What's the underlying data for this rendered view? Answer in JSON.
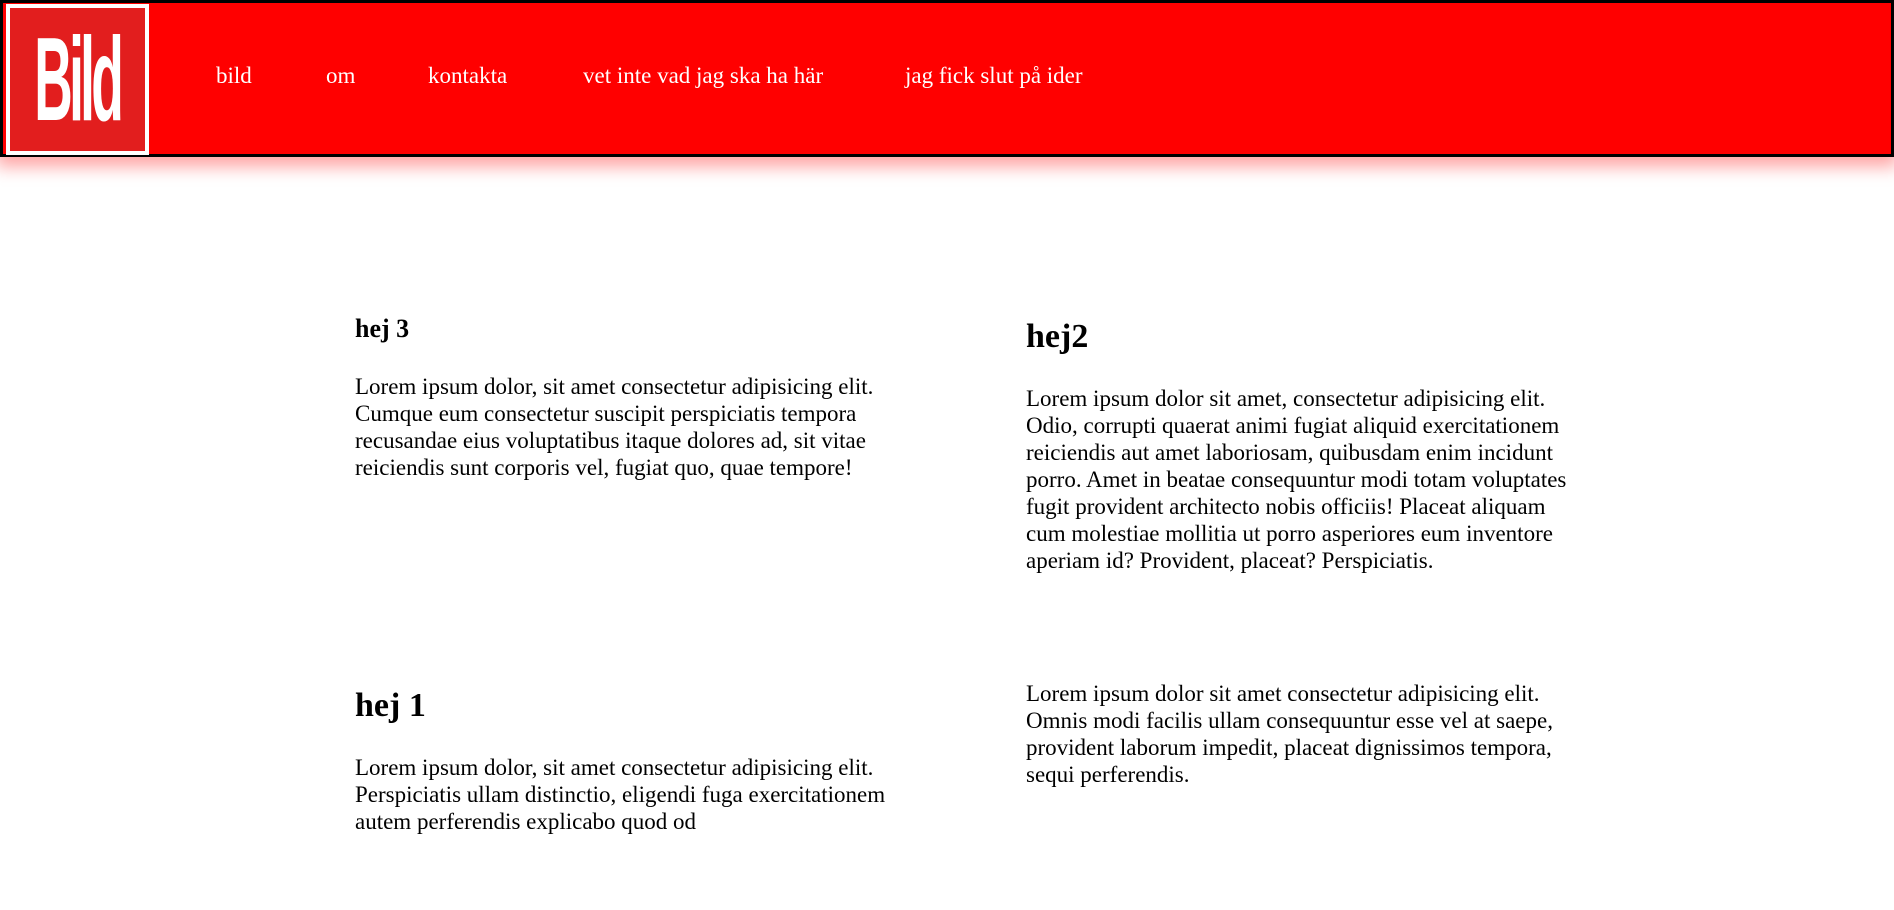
{
  "header": {
    "logo_text": "Bild",
    "nav": [
      "bild",
      "om",
      "kontakta",
      "vet inte vad jag ska ha här",
      "jag fick slut på ider"
    ]
  },
  "sections": [
    {
      "title": "hej 3",
      "text": "Lorem ipsum dolor, sit amet consectetur adipisicing elit. Cumque eum consectetur suscipit perspiciatis tempora recusandae eius voluptatibus itaque dolores ad, sit vitae reiciendis sunt corporis vel, fugiat quo, quae tempore!"
    },
    {
      "title": "hej2",
      "text": "Lorem ipsum dolor sit amet, consectetur adipisicing elit. Odio, corrupti quaerat animi fugiat aliquid exercitationem reiciendis aut amet laboriosam, quibusdam enim incidunt porro. Amet in beatae consequuntur modi totam voluptates fugit provident architecto nobis officiis! Placeat aliquam cum molestiae mollitia ut porro asperiores eum inventore aperiam id? Provident, placeat? Perspiciatis."
    },
    {
      "title": "hej 1",
      "text": "Lorem ipsum dolor, sit amet consectetur adipisicing elit. Perspiciatis ullam distinctio, eligendi fuga exercitationem autem perferendis explicabo quod od"
    },
    {
      "title": "",
      "text": "Lorem ipsum dolor sit amet consectetur adipisicing elit. Omnis modi facilis ullam consequuntur esse vel at saepe, provident laborum impedit, placeat dignissimos tempora, sequi perferendis."
    }
  ],
  "colors": {
    "header_bg": "#ff0000",
    "logo_bg": "#e21e1e",
    "nav_text": "#ffffff",
    "body_text": "#000000"
  }
}
